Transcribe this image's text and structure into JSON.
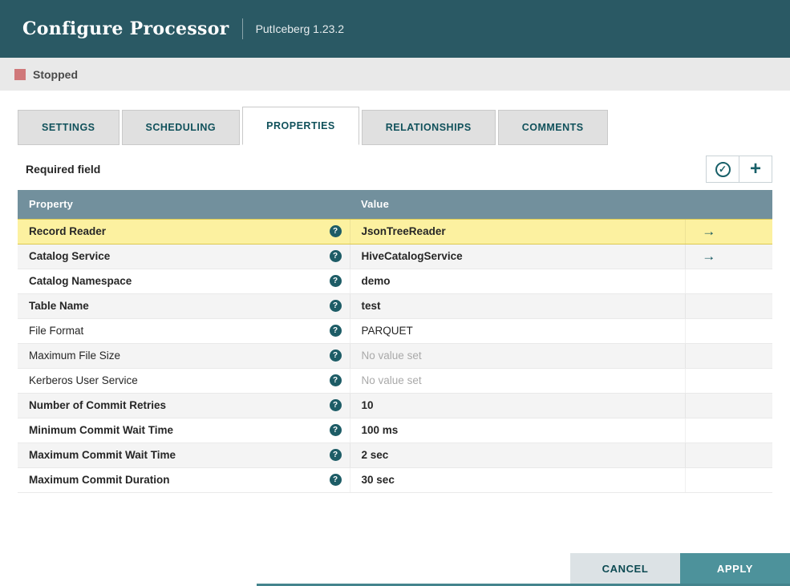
{
  "header": {
    "title": "Configure Processor",
    "subtitle": "PutIceberg 1.23.2"
  },
  "status": {
    "label": "Stopped"
  },
  "tabs": [
    {
      "label": "SETTINGS"
    },
    {
      "label": "SCHEDULING"
    },
    {
      "label": "PROPERTIES"
    },
    {
      "label": "RELATIONSHIPS"
    },
    {
      "label": "COMMENTS"
    }
  ],
  "toolbar": {
    "required_label": "Required field"
  },
  "icons": {
    "verify": "✓",
    "add": "+",
    "help": "?",
    "goto": "→"
  },
  "table": {
    "columns": [
      "Property",
      "Value"
    ],
    "rows": [
      {
        "property": "Record Reader",
        "value": "JsonTreeReader"
      },
      {
        "property": "Catalog Service",
        "value": "HiveCatalogService"
      },
      {
        "property": "Catalog Namespace",
        "value": "demo"
      },
      {
        "property": "Table Name",
        "value": "test"
      },
      {
        "property": "File Format",
        "value": "PARQUET"
      },
      {
        "property": "Maximum File Size",
        "value": "No value set"
      },
      {
        "property": "Kerberos User Service",
        "value": "No value set"
      },
      {
        "property": "Number of Commit Retries",
        "value": "10"
      },
      {
        "property": "Minimum Commit Wait Time",
        "value": "100 ms"
      },
      {
        "property": "Maximum Commit Wait Time",
        "value": "2 sec"
      },
      {
        "property": "Maximum Commit Duration",
        "value": "30 sec"
      }
    ]
  },
  "footer": {
    "cancel_label": "CANCEL",
    "apply_label": "APPLY"
  },
  "colors": {
    "header_bg": "#2A5964",
    "accent_teal": "#0E525C",
    "table_header_bg": "#72909D",
    "selected_row_bg": "#FCF1A0",
    "stopped_red": "#D0787A",
    "apply_bg": "#4D929B"
  }
}
